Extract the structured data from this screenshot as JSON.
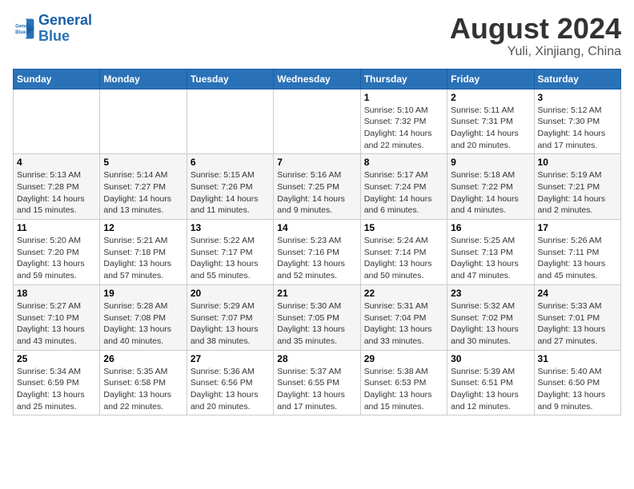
{
  "header": {
    "logo_text_general": "General",
    "logo_text_blue": "Blue",
    "month_year": "August 2024",
    "location": "Yuli, Xinjiang, China"
  },
  "weekdays": [
    "Sunday",
    "Monday",
    "Tuesday",
    "Wednesday",
    "Thursday",
    "Friday",
    "Saturday"
  ],
  "weeks": [
    [
      {
        "day": "",
        "sunrise": "",
        "sunset": "",
        "daylight": ""
      },
      {
        "day": "",
        "sunrise": "",
        "sunset": "",
        "daylight": ""
      },
      {
        "day": "",
        "sunrise": "",
        "sunset": "",
        "daylight": ""
      },
      {
        "day": "",
        "sunrise": "",
        "sunset": "",
        "daylight": ""
      },
      {
        "day": "1",
        "sunrise": "5:10 AM",
        "sunset": "7:32 PM",
        "daylight": "14 hours and 22 minutes."
      },
      {
        "day": "2",
        "sunrise": "5:11 AM",
        "sunset": "7:31 PM",
        "daylight": "14 hours and 20 minutes."
      },
      {
        "day": "3",
        "sunrise": "5:12 AM",
        "sunset": "7:30 PM",
        "daylight": "14 hours and 17 minutes."
      }
    ],
    [
      {
        "day": "4",
        "sunrise": "5:13 AM",
        "sunset": "7:28 PM",
        "daylight": "14 hours and 15 minutes."
      },
      {
        "day": "5",
        "sunrise": "5:14 AM",
        "sunset": "7:27 PM",
        "daylight": "14 hours and 13 minutes."
      },
      {
        "day": "6",
        "sunrise": "5:15 AM",
        "sunset": "7:26 PM",
        "daylight": "14 hours and 11 minutes."
      },
      {
        "day": "7",
        "sunrise": "5:16 AM",
        "sunset": "7:25 PM",
        "daylight": "14 hours and 9 minutes."
      },
      {
        "day": "8",
        "sunrise": "5:17 AM",
        "sunset": "7:24 PM",
        "daylight": "14 hours and 6 minutes."
      },
      {
        "day": "9",
        "sunrise": "5:18 AM",
        "sunset": "7:22 PM",
        "daylight": "14 hours and 4 minutes."
      },
      {
        "day": "10",
        "sunrise": "5:19 AM",
        "sunset": "7:21 PM",
        "daylight": "14 hours and 2 minutes."
      }
    ],
    [
      {
        "day": "11",
        "sunrise": "5:20 AM",
        "sunset": "7:20 PM",
        "daylight": "13 hours and 59 minutes."
      },
      {
        "day": "12",
        "sunrise": "5:21 AM",
        "sunset": "7:18 PM",
        "daylight": "13 hours and 57 minutes."
      },
      {
        "day": "13",
        "sunrise": "5:22 AM",
        "sunset": "7:17 PM",
        "daylight": "13 hours and 55 minutes."
      },
      {
        "day": "14",
        "sunrise": "5:23 AM",
        "sunset": "7:16 PM",
        "daylight": "13 hours and 52 minutes."
      },
      {
        "day": "15",
        "sunrise": "5:24 AM",
        "sunset": "7:14 PM",
        "daylight": "13 hours and 50 minutes."
      },
      {
        "day": "16",
        "sunrise": "5:25 AM",
        "sunset": "7:13 PM",
        "daylight": "13 hours and 47 minutes."
      },
      {
        "day": "17",
        "sunrise": "5:26 AM",
        "sunset": "7:11 PM",
        "daylight": "13 hours and 45 minutes."
      }
    ],
    [
      {
        "day": "18",
        "sunrise": "5:27 AM",
        "sunset": "7:10 PM",
        "daylight": "13 hours and 43 minutes."
      },
      {
        "day": "19",
        "sunrise": "5:28 AM",
        "sunset": "7:08 PM",
        "daylight": "13 hours and 40 minutes."
      },
      {
        "day": "20",
        "sunrise": "5:29 AM",
        "sunset": "7:07 PM",
        "daylight": "13 hours and 38 minutes."
      },
      {
        "day": "21",
        "sunrise": "5:30 AM",
        "sunset": "7:05 PM",
        "daylight": "13 hours and 35 minutes."
      },
      {
        "day": "22",
        "sunrise": "5:31 AM",
        "sunset": "7:04 PM",
        "daylight": "13 hours and 33 minutes."
      },
      {
        "day": "23",
        "sunrise": "5:32 AM",
        "sunset": "7:02 PM",
        "daylight": "13 hours and 30 minutes."
      },
      {
        "day": "24",
        "sunrise": "5:33 AM",
        "sunset": "7:01 PM",
        "daylight": "13 hours and 27 minutes."
      }
    ],
    [
      {
        "day": "25",
        "sunrise": "5:34 AM",
        "sunset": "6:59 PM",
        "daylight": "13 hours and 25 minutes."
      },
      {
        "day": "26",
        "sunrise": "5:35 AM",
        "sunset": "6:58 PM",
        "daylight": "13 hours and 22 minutes."
      },
      {
        "day": "27",
        "sunrise": "5:36 AM",
        "sunset": "6:56 PM",
        "daylight": "13 hours and 20 minutes."
      },
      {
        "day": "28",
        "sunrise": "5:37 AM",
        "sunset": "6:55 PM",
        "daylight": "13 hours and 17 minutes."
      },
      {
        "day": "29",
        "sunrise": "5:38 AM",
        "sunset": "6:53 PM",
        "daylight": "13 hours and 15 minutes."
      },
      {
        "day": "30",
        "sunrise": "5:39 AM",
        "sunset": "6:51 PM",
        "daylight": "13 hours and 12 minutes."
      },
      {
        "day": "31",
        "sunrise": "5:40 AM",
        "sunset": "6:50 PM",
        "daylight": "13 hours and 9 minutes."
      }
    ]
  ]
}
